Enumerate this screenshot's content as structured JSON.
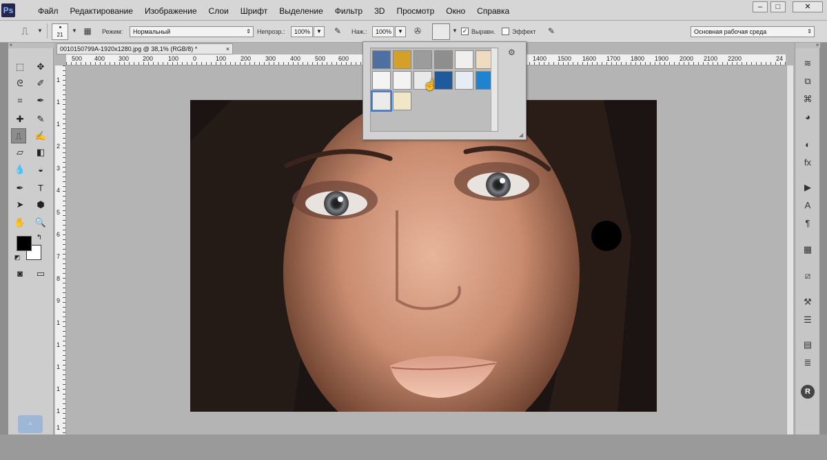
{
  "app": {
    "logo": "Ps"
  },
  "menu": [
    "Файл",
    "Редактирование",
    "Изображение",
    "Слои",
    "Шрифт",
    "Выделение",
    "Фильтр",
    "3D",
    "Просмотр",
    "Окно",
    "Справка"
  ],
  "window_controls": {
    "minimize": "–",
    "maximize": "□",
    "close": "✕"
  },
  "options": {
    "brush_size": "21",
    "mode_label": "Режим:",
    "mode_value": "Нормальный",
    "opacity_label": "Непрозр.:",
    "opacity_value": "100%",
    "pressure_label": "Наж.:",
    "pressure_value": "100%",
    "align_label": "Выравн.",
    "effect_label": "Эффект",
    "workspace": "Основная рабочая среда"
  },
  "document": {
    "tab_title": "0010150799A-1920x1280.jpg @ 38,1% (RGB/8) *"
  },
  "rulers": {
    "h_ticks": [
      "500",
      "400",
      "300",
      "200",
      "100",
      "0",
      "100",
      "200",
      "300",
      "400",
      "500",
      "600",
      "1400",
      "1500",
      "1600",
      "1700",
      "1800",
      "1900",
      "2000",
      "2100",
      "2200",
      "24"
    ],
    "v_ticks": [
      "1",
      "1",
      "1",
      "2",
      "3",
      "4",
      "5",
      "6",
      "7",
      "8",
      "9",
      "1",
      "1",
      "1",
      "1",
      "1",
      "1"
    ]
  },
  "colors": {
    "foreground": "#000000",
    "background": "#ffffff"
  },
  "pattern_picker": {
    "selected_index": 12,
    "swatches": [
      "#4f6fa3",
      "#d4a02a",
      "#9c9c9c",
      "#8e8e8e",
      "#f1efed",
      "#efdcc0",
      "#f4f4f4",
      "#f3f3f3",
      "#e9e9e9",
      "#1f5a9c",
      "#e6ecf4",
      "#1f84cf",
      "#ebebeb",
      "#f0e6c8"
    ]
  }
}
